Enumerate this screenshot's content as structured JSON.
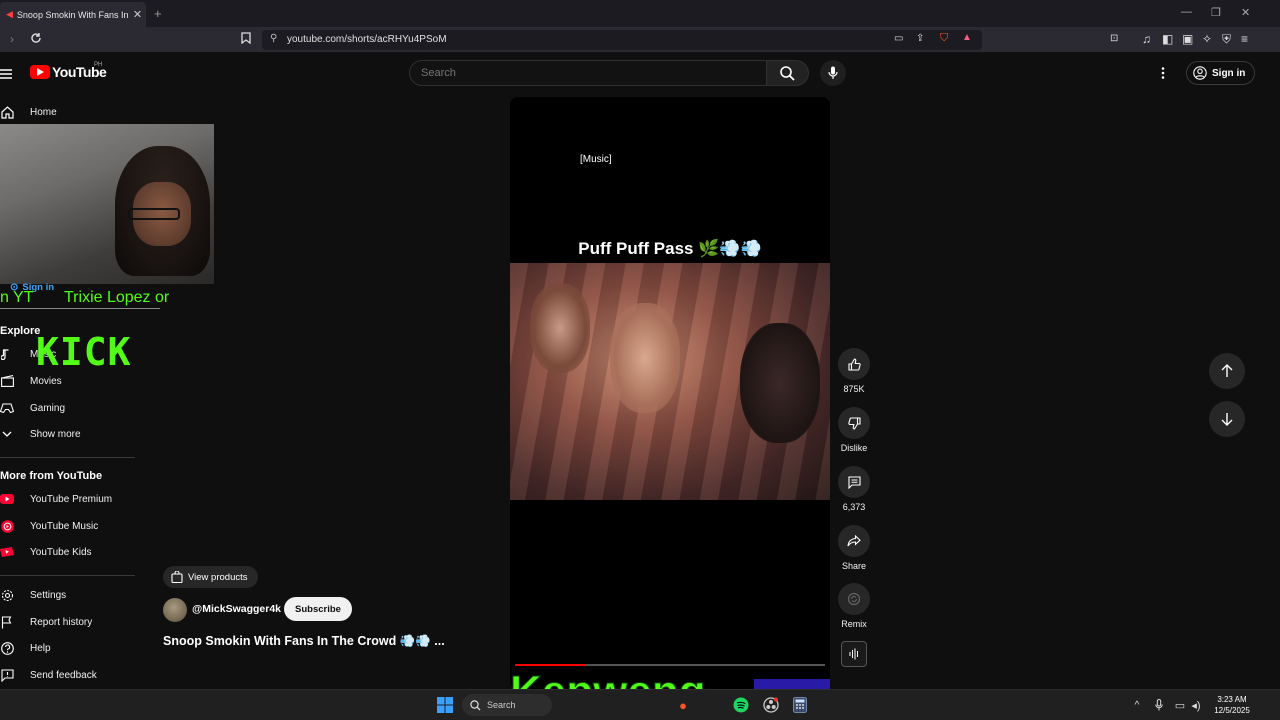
{
  "browser": {
    "tab_title": "Snoop Smokin With Fans In The Crowd",
    "new_tab": "+",
    "url": "youtube.com/shorts/acRHYu4PSoM",
    "window_controls": [
      "—",
      "❐",
      "✕"
    ]
  },
  "header": {
    "logo_text": "YouTube",
    "country_code": "PH",
    "search_placeholder": "Search",
    "signin_label": "Sign in"
  },
  "sidebar": {
    "home": "Home",
    "signin_label": "Sign in",
    "explore_heading": "Explore",
    "explore_items": [
      {
        "label": "Music",
        "icon": "music-note-icon"
      },
      {
        "label": "Movies",
        "icon": "clapperboard-icon"
      },
      {
        "label": "Gaming",
        "icon": "gamepad-icon"
      },
      {
        "label": "Show more",
        "icon": "chevron-down-icon"
      }
    ],
    "more_heading": "More from YouTube",
    "more_items": [
      {
        "label": "YouTube Premium",
        "icon": "yt-premium-icon"
      },
      {
        "label": "YouTube Music",
        "icon": "yt-music-icon"
      },
      {
        "label": "YouTube Kids",
        "icon": "yt-kids-icon"
      }
    ],
    "bottom_items": [
      {
        "label": "Settings",
        "icon": "gear-icon"
      },
      {
        "label": "Report history",
        "icon": "flag-icon"
      },
      {
        "label": "Help",
        "icon": "help-icon"
      },
      {
        "label": "Send feedback",
        "icon": "feedback-icon"
      }
    ]
  },
  "player": {
    "caption": "[Music]",
    "overlay_title": "Puff Puff Pass 🌿💨💨",
    "progress_fraction": 0.23
  },
  "actions": {
    "likes": "875K",
    "dislike": "Dislike",
    "comments": "6,373",
    "share": "Share",
    "remix": "Remix"
  },
  "video": {
    "view_products": "View products",
    "channel": "@MickSwagger4k",
    "subscribe": "Subscribe",
    "title": "Snoop Smokin With Fans In The Crowd 💨💨 ..."
  },
  "overlays": {
    "yt_fragment": "n YT",
    "streamer": "Trixie Lopez or",
    "kick": "KICK",
    "kepweng": "Kepweng"
  },
  "taskbar": {
    "search": "Search",
    "time": "3:23 AM",
    "date": "12/5/2025"
  },
  "colors": {
    "yt_red": "#ff0000",
    "kick_green": "#53fc18",
    "background": "#0f0f0f"
  }
}
